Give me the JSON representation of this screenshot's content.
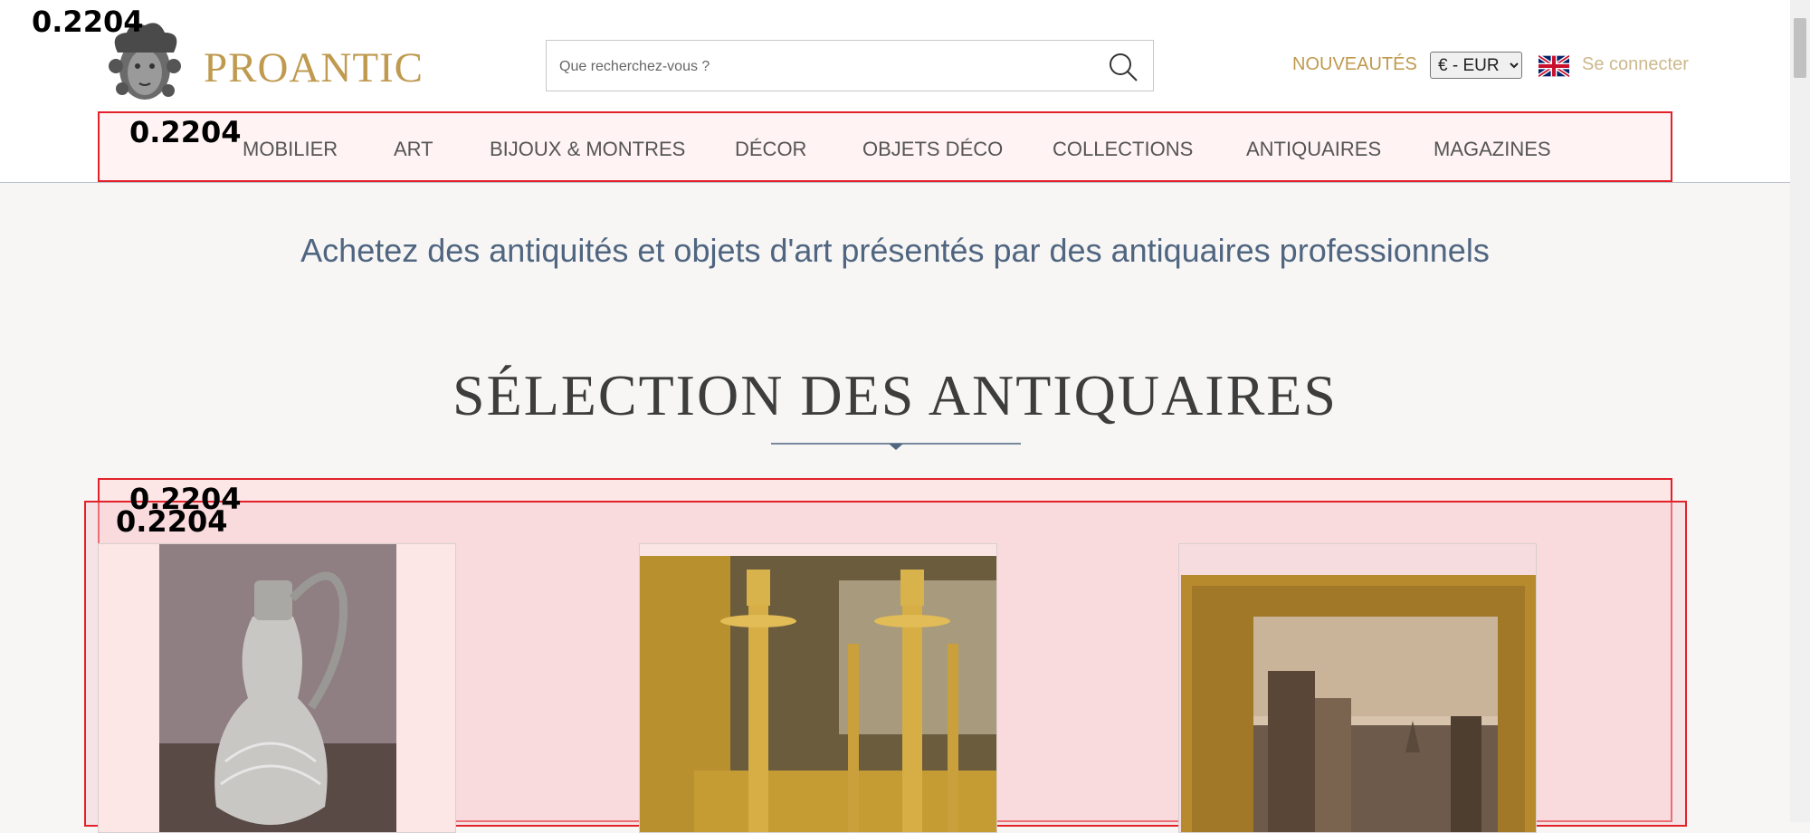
{
  "header": {
    "logo_text": "PROANTIC",
    "search_placeholder": "Que recherchez-vous ?",
    "nouveautes": "NOUVEAUTÉS",
    "currency_selected": "€ - EUR",
    "login": "Se connecter"
  },
  "scores": {
    "logo": "0.2204",
    "nav": "0.2204",
    "selection_outer": "0.2204",
    "selection_inner": "0.2204"
  },
  "nav": {
    "items": [
      "MOBILIER",
      "ART",
      "BIJOUX & MONTRES",
      "DÉCOR",
      "OBJETS DÉCO",
      "COLLECTIONS",
      "ANTIQUAIRES",
      "MAGAZINES"
    ]
  },
  "main": {
    "tagline": "Achetez des antiquités et objets d'art présentés par des antiquaires professionnels",
    "section_title": "SÉLECTION DES ANTIQUAIRES"
  },
  "cards": [
    {
      "icon": "silver-ewer-image"
    },
    {
      "icon": "gilt-candlesticks-image"
    },
    {
      "icon": "framed-painting-image"
    }
  ],
  "colors": {
    "brand_gold": "#bf9a4f",
    "highlight_red": "#e2222a",
    "tagline_blue": "#4f6580"
  }
}
